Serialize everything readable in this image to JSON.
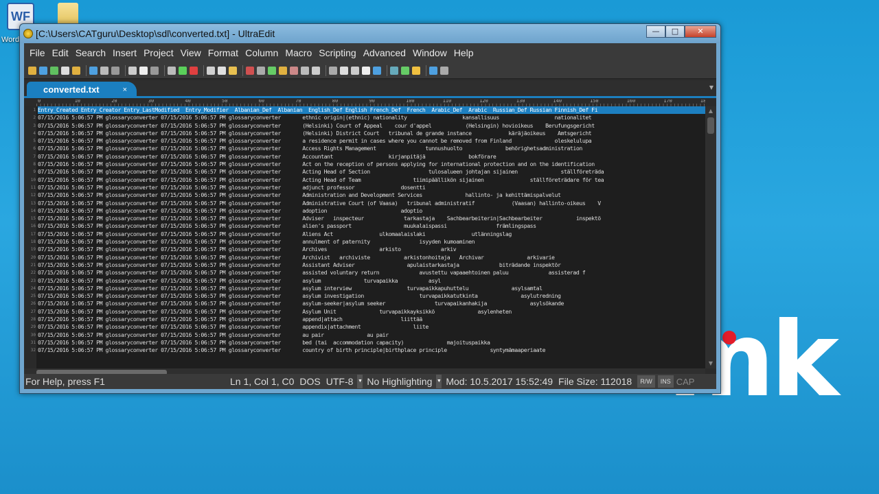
{
  "desktop": {
    "icons": [
      {
        "label": "Word",
        "glyph": "WF"
      }
    ],
    "brand_text": "mk"
  },
  "window": {
    "title": "[C:\\Users\\CATguru\\Desktop\\sdl\\converted.txt] - UltraEdit",
    "buttons": {
      "minimize": "—",
      "maximize": "□",
      "close": "✕"
    }
  },
  "menu": [
    "File",
    "Edit",
    "Search",
    "Insert",
    "Project",
    "View",
    "Format",
    "Column",
    "Macro",
    "Scripting",
    "Advanced",
    "Window",
    "Help"
  ],
  "tab": {
    "label": "converted.txt",
    "close": "×"
  },
  "ruler": [
    "0",
    "10",
    "20",
    "30",
    "40",
    "50",
    "60",
    "70",
    "80",
    "90",
    "100",
    "110",
    "120",
    "130",
    "140",
    "150",
    "160",
    "170",
    "180"
  ],
  "editor_lines": [
    "Entry_Created Entry_Creator Entry_LastModified  Entry_Modifier  Albanian_Def  Albanian  English_Def English French_Def  French  Arabic_Def  Arabic  Russian_Def Russian Finnish_Def Fi",
    "07/15/2016 5:06:57 PM glossaryconverter 07/15/2016 5:06:57 PM glossaryconverter       ethnic origin|(ethnic) nationality                  kansallisuus                  nationalitet",
    "07/15/2016 5:06:57 PM glossaryconverter 07/15/2016 5:06:57 PM glossaryconverter       (Helsinki) Court of Appeal    cour d'appel           (Helsingin) hovioikeus    Berufungsgericht",
    "07/15/2016 5:06:57 PM glossaryconverter 07/15/2016 5:06:57 PM glossaryconverter       (Helsinki) District Court   tribunal de grande instance            käräjäoikeus    Amtsgericht",
    "07/15/2016 5:06:57 PM glossaryconverter 07/15/2016 5:06:57 PM glossaryconverter       a residence permit in cases where you cannot be removed from Finland              oleskelulupa",
    "07/15/2016 5:06:57 PM glossaryconverter 07/15/2016 5:06:57 PM glossaryconverter       Access Rights Management                tunnushuolto              behörighetsadministration",
    "07/15/2016 5:06:57 PM glossaryconverter 07/15/2016 5:06:57 PM glossaryconverter       Accountant                  kirjanpitäjä              bokförare",
    "07/15/2016 5:06:57 PM glossaryconverter 07/15/2016 5:06:57 PM glossaryconverter       Act on the reception of persons applying for international protection and on the identification",
    "07/15/2016 5:06:57 PM glossaryconverter 07/15/2016 5:06:57 PM glossaryconverter       Acting Head of Section                   tulosalueen johtajan sijainen              ställföreträda",
    "07/15/2016 5:06:57 PM glossaryconverter 07/15/2016 5:06:57 PM glossaryconverter       Acting Head of Team                 tiimipäällikön sijainen               ställföreträdare för tea",
    "07/15/2016 5:06:57 PM glossaryconverter 07/15/2016 5:06:57 PM glossaryconverter       adjunct professor               dosentti",
    "07/15/2016 5:06:57 PM glossaryconverter 07/15/2016 5:06:57 PM glossaryconverter       Administration and Development Services              hallinto- ja kehittämispalvelut",
    "07/15/2016 5:06:57 PM glossaryconverter 07/15/2016 5:06:57 PM glossaryconverter       Administrative Court (of Vaasa)   tribunal administratif            (Vaasan) hallinto-oikeus    V",
    "07/15/2016 5:06:57 PM glossaryconverter 07/15/2016 5:06:57 PM glossaryconverter       adoption                        adoptio",
    "07/15/2016 5:06:57 PM glossaryconverter 07/15/2016 5:06:57 PM glossaryconverter       Adviser   inspecteur             tarkastaja    Sachbearbeiterin|Sachbearbeiter           inspektö",
    "07/15/2016 5:06:57 PM glossaryconverter 07/15/2016 5:06:57 PM glossaryconverter       alien's passport                 muukalaispassi                främlingspass",
    "07/15/2016 5:06:57 PM glossaryconverter 07/15/2016 5:06:57 PM glossaryconverter       Aliens Act               ulkomaalaislaki               utlänningslag",
    "07/15/2016 5:06:57 PM glossaryconverter 07/15/2016 5:06:57 PM glossaryconverter       annulment of paternity                isyyden kumoaminen",
    "07/15/2016 5:06:57 PM glossaryconverter 07/15/2016 5:06:57 PM glossaryconverter       Archives                 arkisto             arkiv",
    "07/15/2016 5:06:57 PM glossaryconverter 07/15/2016 5:06:57 PM glossaryconverter       Archivist   archiviste           arkistonhoitaja   Archivar              arkivarie",
    "07/15/2016 5:06:57 PM glossaryconverter 07/15/2016 5:06:57 PM glossaryconverter       Assistant Adviser                 apulaistarkastaja             biträdande inspektör",
    "07/15/2016 5:06:57 PM glossaryconverter 07/15/2016 5:06:57 PM glossaryconverter       assisted voluntary return             avustettu vapaaehtoinen paluu             assisterad f",
    "07/15/2016 5:06:57 PM glossaryconverter 07/15/2016 5:06:57 PM glossaryconverter       asylum              turvapaikka          asyl",
    "07/15/2016 5:06:57 PM glossaryconverter 07/15/2016 5:06:57 PM glossaryconverter       asylum interview                  turvapaikkapuhuttelu              asylsamtal",
    "07/15/2016 5:06:57 PM glossaryconverter 07/15/2016 5:06:57 PM glossaryconverter       asylum investigation                  turvapaikkatutkinta              asylutredning",
    "07/15/2016 5:06:57 PM glossaryconverter 07/15/2016 5:06:57 PM glossaryconverter       asylum-seeker|asylum seeker                turvapaikanhakija              asylsökande",
    "07/15/2016 5:06:57 PM glossaryconverter 07/15/2016 5:06:57 PM glossaryconverter       Asylum Unit              turvapaikkayksikkö              asylenheten",
    "07/15/2016 5:06:57 PM glossaryconverter 07/15/2016 5:06:57 PM glossaryconverter       append|attach                   liittää",
    "07/15/2016 5:06:57 PM glossaryconverter 07/15/2016 5:06:57 PM glossaryconverter       appendix|attachment                 liite",
    "07/15/2016 5:06:57 PM glossaryconverter 07/15/2016 5:06:57 PM glossaryconverter       au pair              au pair",
    "07/15/2016 5:06:57 PM glossaryconverter 07/15/2016 5:06:57 PM glossaryconverter       bed (tai  accommodation capacity)              majoituspaikka",
    "07/15/2016 5:06:57 PM glossaryconverter 07/15/2016 5:06:57 PM glossaryconverter       country of birth principle|birthplace principle              syntymämaaperiaate"
  ],
  "status": {
    "help": "For Help, press F1",
    "position": "Ln 1, Col 1, C0",
    "line_ending": "DOS",
    "encoding": "UTF-8",
    "highlighting": "No Highlighting",
    "modified": "Mod: 10.5.2017 15:52:49",
    "file_size": "File Size: 112018",
    "rw": "R/W",
    "ins": "INS",
    "cap": "CAP"
  },
  "colors": {
    "tab_accent": "#1b7fc0",
    "editor_bg": "#1e1e1e",
    "desktop_bg": "#1a9ad6"
  }
}
